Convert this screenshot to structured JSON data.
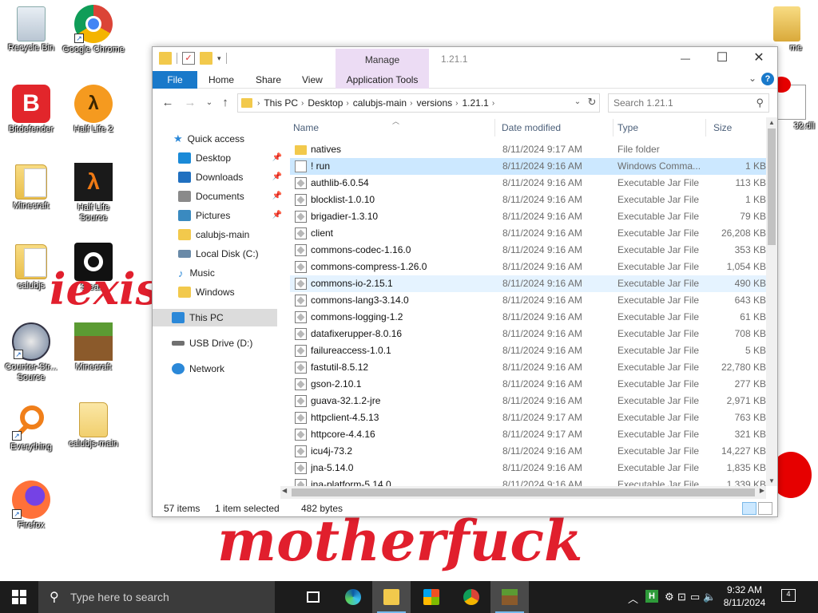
{
  "desktop": {
    "icons": [
      {
        "id": "recycle",
        "label": "Recycle Bin"
      },
      {
        "id": "chrome",
        "label": "Google Chrome"
      },
      {
        "id": "bitdefender",
        "label": "Bitdefender"
      },
      {
        "id": "hl2",
        "label": "Half Life 2"
      },
      {
        "id": "minecraft-folder",
        "label": "Minecraft"
      },
      {
        "id": "hl-source",
        "label": "Half Life Source"
      },
      {
        "id": "calubjs",
        "label": "calubjs"
      },
      {
        "id": "steam",
        "label": "Steam"
      },
      {
        "id": "css",
        "label": "Counter-Str... Source"
      },
      {
        "id": "minecraft",
        "label": "Minecraft"
      },
      {
        "id": "everything",
        "label": "Everything"
      },
      {
        "id": "calubjs-main",
        "label": "calubjs-main"
      },
      {
        "id": "firefox",
        "label": "Firefox"
      },
      {
        "id": "me-folder",
        "label": "me"
      },
      {
        "id": "dll",
        "label": "32.dll"
      }
    ],
    "graffiti_top": "iexis",
    "graffiti_bottom": "motherfuck"
  },
  "window": {
    "title": "1.21.1",
    "manage_tab": "Manage",
    "ribbon_tabs": [
      "File",
      "Home",
      "Share",
      "View",
      "Application Tools"
    ],
    "controls": {
      "minimize": "—",
      "maximize": "☐",
      "close": "✕"
    },
    "help": "?"
  },
  "address": {
    "crumbs": [
      "This PC",
      "Desktop",
      "calubjs-main",
      "versions",
      "1.21.1"
    ]
  },
  "search": {
    "placeholder": "Search 1.21.1"
  },
  "nav": {
    "items": [
      {
        "label": "Quick access",
        "color": "#2b88d8"
      },
      {
        "label": "Desktop",
        "color": "#1a8ad8",
        "pinned": true
      },
      {
        "label": "Downloads",
        "color": "#2070c0",
        "pinned": true
      },
      {
        "label": "Documents",
        "color": "#8a8a8a",
        "pinned": true
      },
      {
        "label": "Pictures",
        "color": "#3a8ac0",
        "pinned": true
      },
      {
        "label": "calubjs-main",
        "color": "#f2c94c"
      },
      {
        "label": "Local Disk (C:)",
        "color": "#6a8aa8"
      },
      {
        "label": "Music",
        "color": "#2b88d8"
      },
      {
        "label": "Windows",
        "color": "#f2c94c"
      },
      {
        "label": "This PC",
        "color": "#2b88d8"
      },
      {
        "label": "USB Drive (D:)",
        "color": "#707070"
      },
      {
        "label": "Network",
        "color": "#2b88d8"
      }
    ]
  },
  "columns": {
    "name": "Name",
    "date": "Date modified",
    "type": "Type",
    "size": "Size"
  },
  "files": [
    {
      "name": "natives",
      "date": "8/11/2024 9:17 AM",
      "type": "File folder",
      "size": "",
      "icon": "folder"
    },
    {
      "name": "! run",
      "date": "8/11/2024 9:16 AM",
      "type": "Windows Comma...",
      "size": "1 KB",
      "icon": "cmd"
    },
    {
      "name": "authlib-6.0.54",
      "date": "8/11/2024 9:16 AM",
      "type": "Executable Jar File",
      "size": "113 KB",
      "icon": "jar"
    },
    {
      "name": "blocklist-1.0.10",
      "date": "8/11/2024 9:16 AM",
      "type": "Executable Jar File",
      "size": "1 KB",
      "icon": "jar"
    },
    {
      "name": "brigadier-1.3.10",
      "date": "8/11/2024 9:16 AM",
      "type": "Executable Jar File",
      "size": "79 KB",
      "icon": "jar"
    },
    {
      "name": "client",
      "date": "8/11/2024 9:16 AM",
      "type": "Executable Jar File",
      "size": "26,208 KB",
      "icon": "jar"
    },
    {
      "name": "commons-codec-1.16.0",
      "date": "8/11/2024 9:16 AM",
      "type": "Executable Jar File",
      "size": "353 KB",
      "icon": "jar"
    },
    {
      "name": "commons-compress-1.26.0",
      "date": "8/11/2024 9:16 AM",
      "type": "Executable Jar File",
      "size": "1,054 KB",
      "icon": "jar"
    },
    {
      "name": "commons-io-2.15.1",
      "date": "8/11/2024 9:16 AM",
      "type": "Executable Jar File",
      "size": "490 KB",
      "icon": "jar"
    },
    {
      "name": "commons-lang3-3.14.0",
      "date": "8/11/2024 9:16 AM",
      "type": "Executable Jar File",
      "size": "643 KB",
      "icon": "jar"
    },
    {
      "name": "commons-logging-1.2",
      "date": "8/11/2024 9:16 AM",
      "type": "Executable Jar File",
      "size": "61 KB",
      "icon": "jar"
    },
    {
      "name": "datafixerupper-8.0.16",
      "date": "8/11/2024 9:16 AM",
      "type": "Executable Jar File",
      "size": "708 KB",
      "icon": "jar"
    },
    {
      "name": "failureaccess-1.0.1",
      "date": "8/11/2024 9:16 AM",
      "type": "Executable Jar File",
      "size": "5 KB",
      "icon": "jar"
    },
    {
      "name": "fastutil-8.5.12",
      "date": "8/11/2024 9:16 AM",
      "type": "Executable Jar File",
      "size": "22,780 KB",
      "icon": "jar"
    },
    {
      "name": "gson-2.10.1",
      "date": "8/11/2024 9:16 AM",
      "type": "Executable Jar File",
      "size": "277 KB",
      "icon": "jar"
    },
    {
      "name": "guava-32.1.2-jre",
      "date": "8/11/2024 9:16 AM",
      "type": "Executable Jar File",
      "size": "2,971 KB",
      "icon": "jar"
    },
    {
      "name": "httpclient-4.5.13",
      "date": "8/11/2024 9:17 AM",
      "type": "Executable Jar File",
      "size": "763 KB",
      "icon": "jar"
    },
    {
      "name": "httpcore-4.4.16",
      "date": "8/11/2024 9:17 AM",
      "type": "Executable Jar File",
      "size": "321 KB",
      "icon": "jar"
    },
    {
      "name": "icu4j-73.2",
      "date": "8/11/2024 9:16 AM",
      "type": "Executable Jar File",
      "size": "14,227 KB",
      "icon": "jar"
    },
    {
      "name": "jna-5.14.0",
      "date": "8/11/2024 9:16 AM",
      "type": "Executable Jar File",
      "size": "1,835 KB",
      "icon": "jar"
    },
    {
      "name": "jna-platform-5.14.0",
      "date": "8/11/2024 9:16 AM",
      "type": "Executable Jar File",
      "size": "1,339 KB",
      "icon": "jar"
    }
  ],
  "selected_row": "! run",
  "hover_row": "commons-io-2.15.1",
  "status": {
    "items": "57 items",
    "selection": "1 item selected",
    "size": "482 bytes"
  },
  "taskbar": {
    "search_placeholder": "Type here to search",
    "time": "9:32 AM",
    "date": "8/11/2024",
    "notifications": "4"
  },
  "colors": {
    "accent": "#1979ca",
    "selected": "#cce8ff",
    "hover": "#e5f3ff",
    "graffiti": "#e11f2d"
  }
}
